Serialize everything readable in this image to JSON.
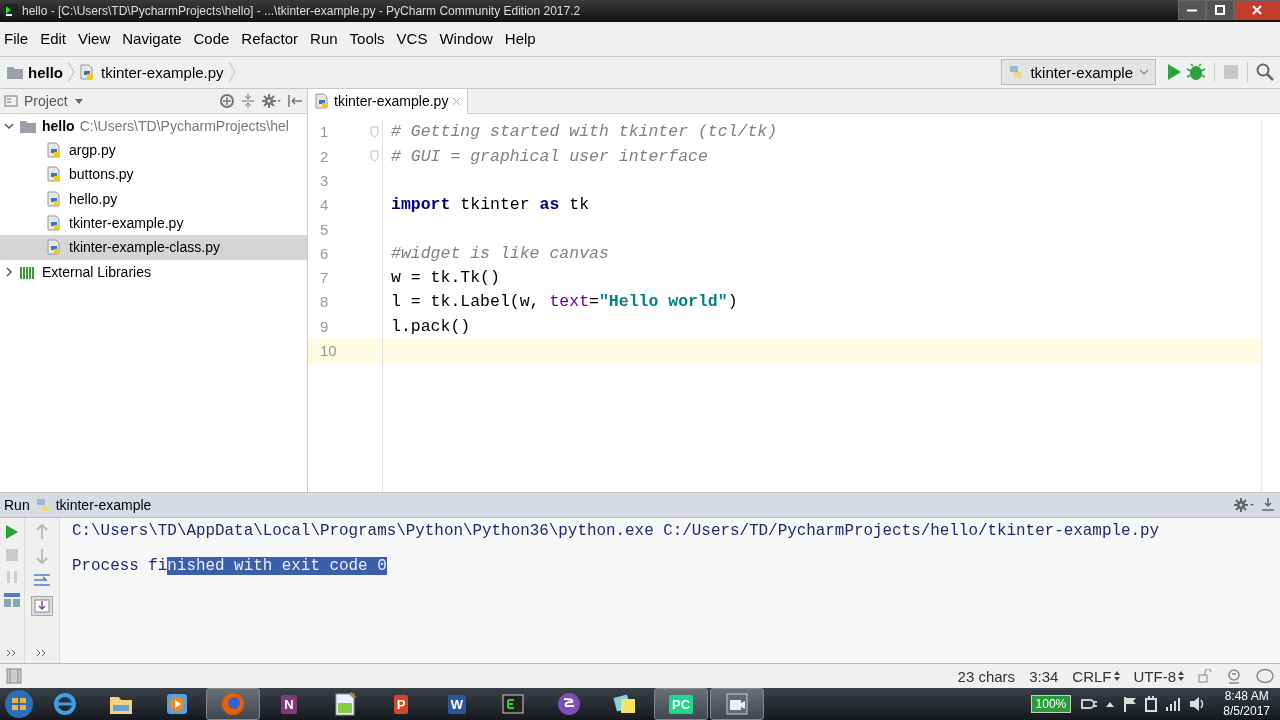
{
  "window": {
    "title": "hello - [C:\\Users\\TD\\PycharmProjects\\hello] - ...\\tkinter-example.py - PyCharm Community Edition 2017.2"
  },
  "menu": [
    "File",
    "Edit",
    "View",
    "Navigate",
    "Code",
    "Refactor",
    "Run",
    "Tools",
    "VCS",
    "Window",
    "Help"
  ],
  "breadcrumbs": [
    {
      "label": "hello",
      "kind": "folder"
    },
    {
      "label": "tkinter-example.py",
      "kind": "file"
    }
  ],
  "run_config": {
    "label": "tkinter-example"
  },
  "project": {
    "title": "Project",
    "tree": [
      {
        "label": "hello",
        "path": "C:\\Users\\TD\\PycharmProjects\\hel",
        "kind": "folder",
        "expanded": true,
        "selected": false,
        "children": [
          {
            "label": "argp.py",
            "kind": "file",
            "selected": false
          },
          {
            "label": "buttons.py",
            "kind": "file",
            "selected": false
          },
          {
            "label": "hello.py",
            "kind": "file",
            "selected": false
          },
          {
            "label": "tkinter-example.py",
            "kind": "file",
            "selected": false
          },
          {
            "label": "tkinter-example-class.py",
            "kind": "file",
            "selected": true
          }
        ]
      },
      {
        "label": "External Libraries",
        "kind": "library",
        "expanded": false,
        "selected": false
      }
    ]
  },
  "editor": {
    "tabs": [
      {
        "label": "tkinter-example.py",
        "selected": true
      }
    ],
    "lines": [
      {
        "number": "1",
        "fold": true,
        "current": false,
        "segments": [
          {
            "text": "# Getting started with tkinter (tcl/tk)",
            "kind": "comment"
          }
        ]
      },
      {
        "number": "2",
        "fold": true,
        "current": false,
        "segments": [
          {
            "text": "# GUI = graphical user interface",
            "kind": "comment"
          }
        ]
      },
      {
        "number": "3",
        "fold": false,
        "current": false
      },
      {
        "number": "4",
        "fold": false,
        "current": false,
        "segments": [
          {
            "text": "import",
            "kind": "keyword"
          },
          {
            "text": " tkinter ",
            "kind": "plain"
          },
          {
            "text": "as",
            "kind": "keyword"
          },
          {
            "text": " tk",
            "kind": "plain"
          }
        ]
      },
      {
        "number": "5",
        "fold": false,
        "current": false
      },
      {
        "number": "6",
        "fold": false,
        "current": false,
        "segments": [
          {
            "text": "#widget is like canvas",
            "kind": "comment"
          }
        ]
      },
      {
        "number": "7",
        "fold": false,
        "current": false,
        "segments": [
          {
            "text": "w = tk.Tk()",
            "kind": "plain"
          }
        ]
      },
      {
        "number": "8",
        "fold": false,
        "current": false,
        "segments": [
          {
            "text": "l = tk.Label(w, ",
            "kind": "plain"
          },
          {
            "text": "text",
            "kind": "param"
          },
          {
            "text": "=",
            "kind": "plain"
          },
          {
            "text": "\"Hello world\"",
            "kind": "string"
          },
          {
            "text": ")",
            "kind": "plain"
          }
        ]
      },
      {
        "number": "9",
        "fold": false,
        "current": false,
        "segments": [
          {
            "text": "l.pack()",
            "kind": "plain"
          }
        ]
      },
      {
        "number": "10",
        "fold": false,
        "current": true
      }
    ]
  },
  "run": {
    "title": "Run",
    "config": "tkinter-example",
    "lines": [
      {
        "segments": [
          {
            "text": "C:\\Users\\TD\\AppData\\Local\\Programs\\Python\\Python36\\python.exe C:/Users/TD/PycharmProjects/hello/tkinter-example.py",
            "selected": false
          }
        ]
      },
      {
        "segments": [
          {
            "text": "Process fi",
            "selected": false
          },
          {
            "text": "nished with exit code 0",
            "selected": true
          }
        ]
      }
    ]
  },
  "status_bar": [
    {
      "text": "23 chars",
      "kind": "text"
    },
    {
      "text": "3:34",
      "kind": "text"
    },
    {
      "text": "CRLF",
      "kind": "dropdown"
    },
    {
      "text": "UTF-8",
      "kind": "dropdown"
    }
  ],
  "taskbar": {
    "apps": [
      {
        "kind": "browser-e",
        "selected": false
      },
      {
        "kind": "folder",
        "selected": false
      },
      {
        "kind": "player",
        "selected": false
      },
      {
        "kind": "firefox",
        "selected": true
      },
      {
        "kind": "letter",
        "label": "N",
        "color": "#80397b",
        "selected": false
      },
      {
        "kind": "notepad",
        "selected": false
      },
      {
        "kind": "letter",
        "label": "P",
        "color": "#d24726",
        "selected": false
      },
      {
        "kind": "letter",
        "label": "W",
        "color": "#2b579a",
        "selected": false
      },
      {
        "kind": "terminal",
        "selected": false
      },
      {
        "kind": "emacs",
        "selected": false
      },
      {
        "kind": "notes",
        "selected": false
      },
      {
        "kind": "letter",
        "label": "PC",
        "color": "#21d789",
        "selected": true
      },
      {
        "kind": "video",
        "selected": true
      }
    ],
    "battery": "100%",
    "time": "8:48 AM",
    "date": "8/5/2017"
  }
}
